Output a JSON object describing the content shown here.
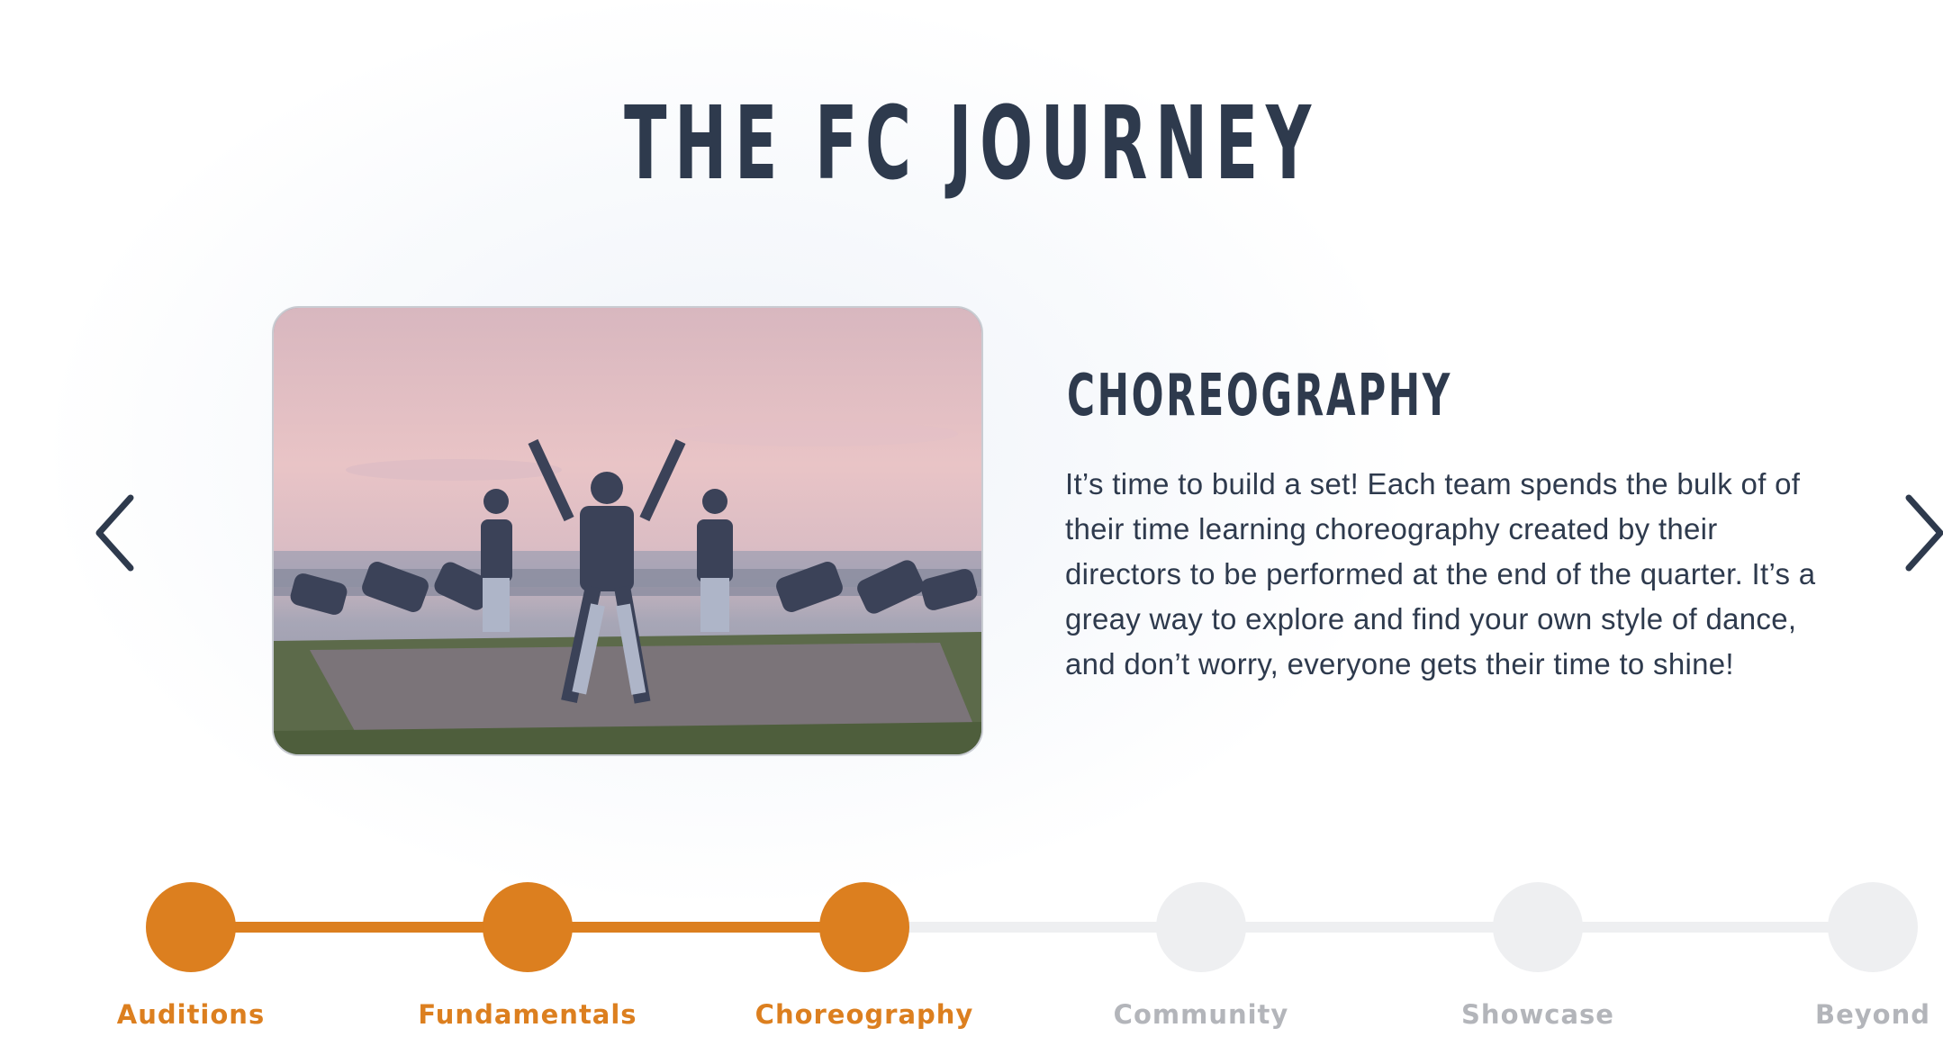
{
  "page": {
    "title": "THE FC JOURNEY"
  },
  "colors": {
    "active": "#dc7f1f",
    "inactive": "#eeeff1",
    "inactive_label": "#b3b5ba",
    "text": "#2e3a4d"
  },
  "carousel": {
    "prev_icon": "chevron-left-icon",
    "next_icon": "chevron-right-icon",
    "current_index": 2,
    "image_alt": "Dance team performing choreography outdoors at sunset",
    "stage_title": "CHOREOGRAPHY",
    "description": "It’s time to build a set! Each team spends the bulk of of their time learning choreography created by their directors to be performed at the end of the quarter. It’s a greay way to explore and find your own style of dance, and don’t worry, everyone gets their time to shine!"
  },
  "timeline": {
    "steps": [
      {
        "label": "Auditions",
        "completed": true
      },
      {
        "label": "Fundamentals",
        "completed": true
      },
      {
        "label": "Choreography",
        "completed": true
      },
      {
        "label": "Community",
        "completed": false
      },
      {
        "label": "Showcase",
        "completed": false
      },
      {
        "label": "Beyond",
        "completed": false
      }
    ]
  }
}
